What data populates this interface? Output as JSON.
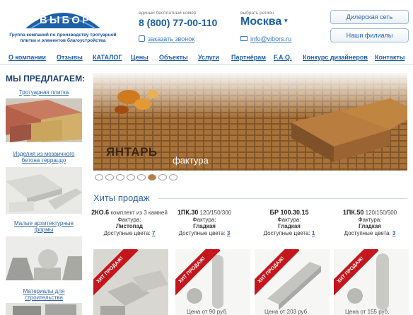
{
  "logo": {
    "word": "ВЫБОР",
    "subtitle": "Группа компаний по производству тротуарной плитки и элементов благоустройства"
  },
  "contact": {
    "free_label": "единый бесплатный номер",
    "phone": "8 (800) 77-00-110",
    "callback": "заказать звонок"
  },
  "region": {
    "label": "выбрать регион",
    "value": "Москва",
    "email": "info@vibors.ru"
  },
  "buttons": {
    "dealer": "Дилерская сеть",
    "branches": "Наши филиалы"
  },
  "nav": [
    "О компании",
    "Отзывы",
    "КАТАЛОГ",
    "Цены",
    "Объекты",
    "Услуги",
    "Партнёрам",
    "F.A.Q.",
    "Конкурс дизайнеров",
    "Контакты"
  ],
  "sidebar": {
    "title": "МЫ ПРЕДЛАГАЕМ:",
    "items": [
      {
        "label": "Тротуарная плитка"
      },
      {
        "label": "Изделия из мозаичного бетона терраццо"
      },
      {
        "label": "Малые архитектурные формы"
      },
      {
        "label": "Материалы для строительства"
      }
    ]
  },
  "banner": {
    "title": "ЯНТАРЬ",
    "subtitle": "фактура"
  },
  "hits": {
    "title": "Хиты продаж",
    "badge": "ХИТ ПРОДАЖ!"
  },
  "products": [
    {
      "code": "2КО.6",
      "size": "комплект из 3 камней",
      "texture_label": "Фактура:",
      "texture": "Листопад",
      "colors_label": "Доступные цвета:",
      "colors": "7",
      "price": ""
    },
    {
      "code": "1ПК.30",
      "size": "120/150/300",
      "texture_label": "Фактура:",
      "texture": "Гладкая",
      "colors_label": "Доступные цвета:",
      "colors": "3",
      "price": "Цена от 90 руб."
    },
    {
      "code": "БР 100.30.15",
      "size": "",
      "texture_label": "Фактура:",
      "texture": "Гладкая",
      "colors_label": "Доступные цвета:",
      "colors": "1",
      "price": "Цена от 203 руб."
    },
    {
      "code": "1ПК.50",
      "size": "120/150/500",
      "texture_label": "Фактура:",
      "texture": "Гладкая",
      "colors_label": "Доступные цвета:",
      "colors": "3",
      "price": "Цена от 155 руб."
    }
  ]
}
